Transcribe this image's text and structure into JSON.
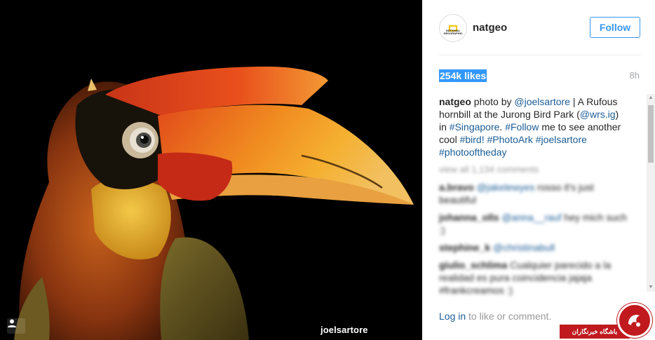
{
  "post": {
    "credit": "joelsartore",
    "username": "natgeo",
    "follow_label": "Follow",
    "likes": "254k likes",
    "time": "8h",
    "avatar_logo_text": "NATIONAL GEOGRAPHIC"
  },
  "caption": {
    "user": "natgeo",
    "t1": " photo by ",
    "m1": "@joelsartore",
    "t2": " | A Rufous hornbill at the Jurong Bird Park (",
    "m2": "@wrs.ig",
    "t3": ") in ",
    "h1": "#Singapore",
    "t4": ". ",
    "h2": "#Follow",
    "t5": " me to see another cool ",
    "h3": "#bird!",
    "t6": " ",
    "h4": "#PhotoArk",
    "t7": " ",
    "h5": "#joelsartore",
    "t8": " ",
    "h6": "#photooftheday"
  },
  "view_all": "view all 1,134 comments",
  "comments": [
    {
      "user": "a.bravo",
      "mention": "@jakelewyes",
      "text": " rosso it's just beautiful"
    },
    {
      "user": "johanna_olls",
      "mention": "@anna__rauf",
      "text": " hey mich such :) "
    },
    {
      "user": "stephine_k",
      "mention": "@christinabull",
      "text": ""
    },
    {
      "user": "giulio_schlima",
      "mention": "",
      "text": " Cualquier parecido a la realidad es pura coincidencia jajaja #frankcreamos :)"
    }
  ],
  "login": {
    "link": "Log in",
    "text": " to like or comment."
  },
  "watermark": {
    "text": "باشگاه خبرنگاران"
  },
  "colors": {
    "link": "#1b5d96",
    "follow": "#3897f0",
    "highlight": "#3297fd",
    "badge": "#c01a1f"
  }
}
